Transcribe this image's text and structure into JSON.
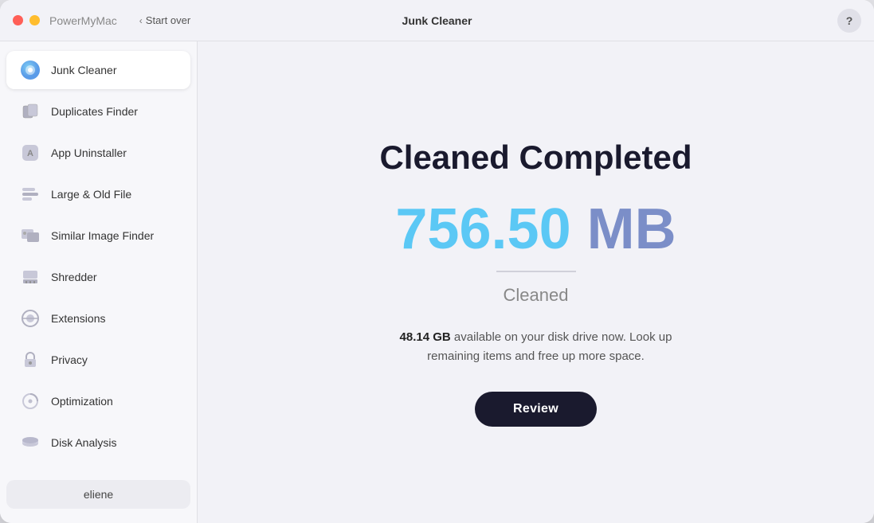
{
  "titlebar": {
    "app_name": "PowerMyMac",
    "start_over_label": "Start over",
    "page_title": "Junk Cleaner",
    "help_label": "?"
  },
  "sidebar": {
    "items": [
      {
        "id": "junk-cleaner",
        "label": "Junk Cleaner",
        "active": true
      },
      {
        "id": "duplicates-finder",
        "label": "Duplicates Finder",
        "active": false
      },
      {
        "id": "app-uninstaller",
        "label": "App Uninstaller",
        "active": false
      },
      {
        "id": "large-old-file",
        "label": "Large & Old File",
        "active": false
      },
      {
        "id": "similar-image-finder",
        "label": "Similar Image Finder",
        "active": false
      },
      {
        "id": "shredder",
        "label": "Shredder",
        "active": false
      },
      {
        "id": "extensions",
        "label": "Extensions",
        "active": false
      },
      {
        "id": "privacy",
        "label": "Privacy",
        "active": false
      },
      {
        "id": "optimization",
        "label": "Optimization",
        "active": false
      },
      {
        "id": "disk-analysis",
        "label": "Disk Analysis",
        "active": false
      }
    ],
    "user_label": "eliene"
  },
  "main": {
    "title": "Cleaned Completed",
    "size_number": "756.50",
    "size_unit": "MB",
    "size_label": "Cleaned",
    "disk_info_bold": "48.14 GB",
    "disk_info_text": " available on your disk drive now. Look up remaining items and free up more space.",
    "review_button_label": "Review"
  }
}
